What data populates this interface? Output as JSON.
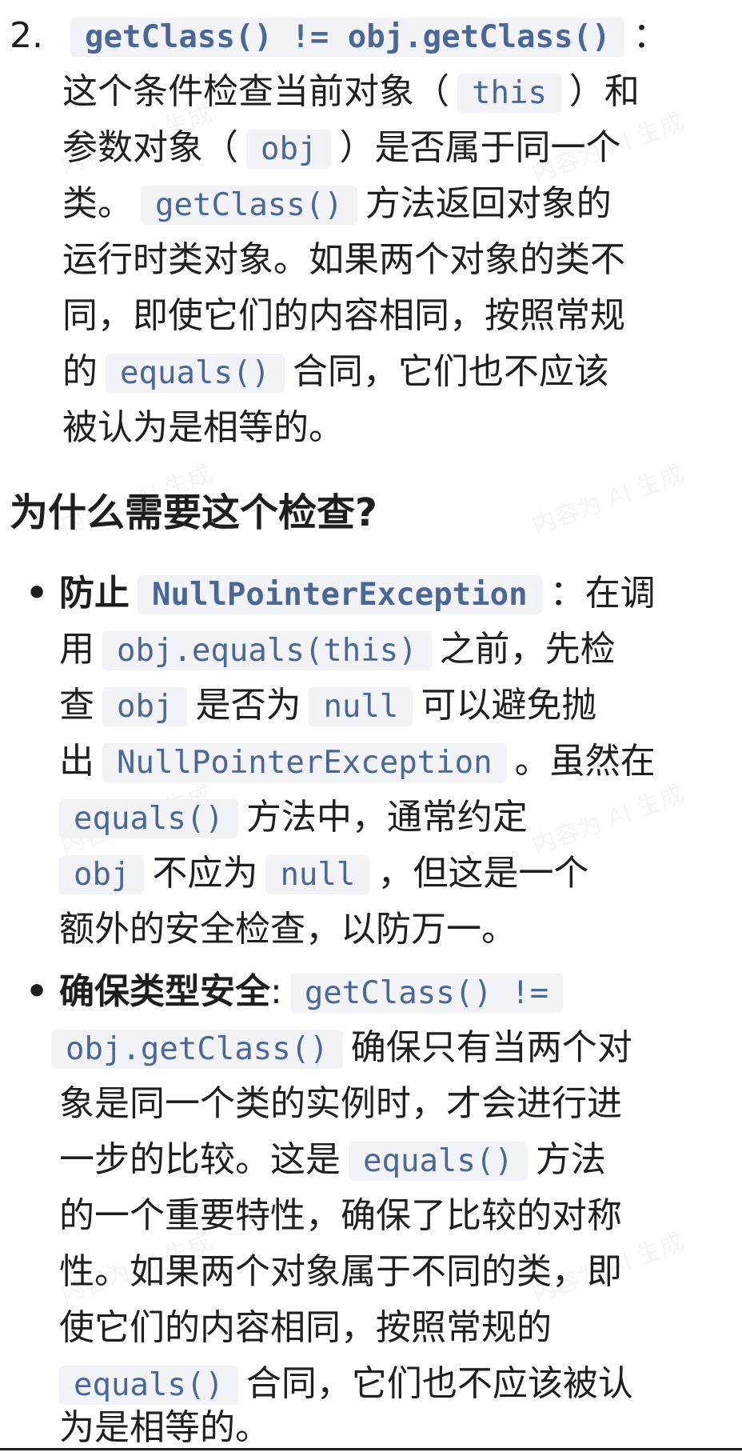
{
  "item2": {
    "number": "2.",
    "code_condition": "getClass() != obj.getClass()",
    "colon": "：",
    "l2a": "这个条件检查当前对象（",
    "code_this": "this",
    "l2b": "）和",
    "l3a": "参数对象（",
    "code_obj": "obj",
    "l3b": "）是否属于同一个",
    "l4a": "类。",
    "code_getclass": "getClass()",
    "l4b": "方法返回对象的",
    "l5": "运行时类对象。如果两个对象的类不",
    "l6": "同，即使它们的内容相同，按照常规",
    "l7a": "的",
    "code_equals": "equals()",
    "l7b": "合同，它们也不应该",
    "l8": "被认为是相等的。"
  },
  "heading": "为什么需要这个检查?",
  "bullet1": {
    "bold": "防止",
    "code_npe": "NullPointerException",
    "l1b": "：在调",
    "l2a": "用",
    "code_call": "obj.equals(this)",
    "l2b": "之前，先检",
    "l3a": "查",
    "code_obj": "obj",
    "l3b": "是否为",
    "code_null": "null",
    "l3c": "可以避免抛",
    "l4a": "出",
    "code_npe2": "NullPointerException",
    "l4b": "。虽然在",
    "code_equals": "equals()",
    "l5b": "方法中，通常约定",
    "code_obj2": "obj",
    "l6b": "不应为",
    "code_null2": "null",
    "l6c": "，但这是一个",
    "l7": "额外的安全检查，以防万一。"
  },
  "bullet2": {
    "bold": "确保类型安全",
    "colon": ":",
    "code_a": "getClass() !=",
    "code_b": "obj.getClass()",
    "l2b": "确保只有当两个对",
    "l3": "象是同一个类的实例时，才会进行进",
    "l4a": "一步的比较。这是",
    "code_equals": "equals()",
    "l4b": "方法",
    "l5": "的一个重要特性，确保了比较的对称",
    "l6": "性。如果两个对象属于不同的类，即",
    "l7": "使它们的内容相同，按照常规的",
    "code_equals2": "equals()",
    "l8b": "合同，它们也不应该被认",
    "l9": "为是相等的。"
  },
  "bullet_glyph": "•"
}
